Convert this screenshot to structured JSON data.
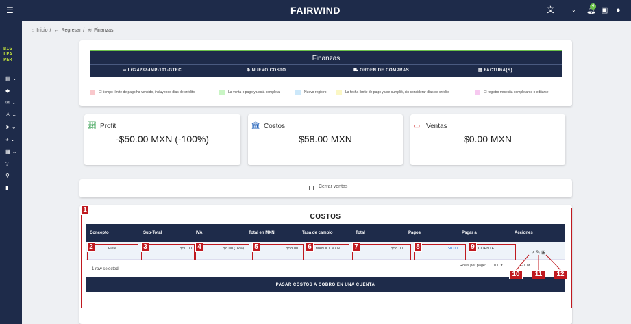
{
  "header": {
    "brand": "FAIRWIND",
    "menu_icon": "hamburger-icon",
    "translate_icon": "translate-icon",
    "notification_count": "4",
    "notification_icon": "bell-icon",
    "chat_icon": "chat-icon",
    "account_icon": "account-icon"
  },
  "sidebar": {
    "logo_lines": [
      "BIG",
      "LEA",
      "PER"
    ]
  },
  "breadcrumb": {
    "home": "Inicio",
    "back": "Regresar",
    "current": "Finanzas"
  },
  "finanzas": {
    "title": "Finanzas",
    "tabs": [
      {
        "label": "LG24237-IMP-101-GTEC",
        "icon": "shipping-icon"
      },
      {
        "label": "NUEVO COSTO",
        "icon": "add-circle-icon"
      },
      {
        "label": "ORDEN DE COMPRAS",
        "icon": "cart-icon"
      },
      {
        "label": "FACTURA(S)",
        "icon": "invoice-icon"
      }
    ]
  },
  "legend": [
    {
      "color": "#f9c8cc",
      "label": "El tiempo límite de pago ha vencido, incluyendo días de crédito"
    },
    {
      "color": "#c9f5c4",
      "label": "La venta o pago ya está completa"
    },
    {
      "color": "#cce8fa",
      "label": "Nuevo registro"
    },
    {
      "color": "#fbf7c4",
      "label": "La fecha límite de pago ya se cumplió, sin considerar días de crédito"
    },
    {
      "color": "#f7c9f0",
      "label": "El registro necesita completarse o editarse"
    }
  ],
  "kpis": {
    "profit": {
      "label": "Profit",
      "value": "-$50.00 MXN (-100%)",
      "icon": "trending-up-icon",
      "color": "#2e9c4a"
    },
    "costos": {
      "label": "Costos",
      "value": "$58.00 MXN",
      "icon": "bank-icon",
      "color": "#1f5fb8"
    },
    "ventas": {
      "label": "Ventas",
      "value": "$0.00 MXN",
      "icon": "credit-card-icon",
      "color": "#d23a3a"
    }
  },
  "cerrar_ventas": "Cerrar ventas",
  "costos": {
    "title": "COSTOS",
    "columns": [
      "Concepto",
      "Sub-Total",
      "IVA",
      "Total en MXN",
      "Tasa de cambio",
      "Total",
      "Pagos",
      "Pagar a",
      "Acciones"
    ],
    "row": {
      "concepto": "Flete",
      "subtotal": "$50.00",
      "iva": "$8.00 (16%)",
      "total_mxn": "$58.00",
      "tasa": "1 MXN = 1 MXN",
      "total": "$58.00",
      "pagos": "$0.00",
      "pagar_a": "EL CLIENTE"
    },
    "selected_text": "1 row selected",
    "rows_per_page_label": "Rows per page:",
    "rows_per_page": "100",
    "range": "1–1 of 1",
    "cobrar_button": "PASAR COSTOS A COBRO EN UNA CUENTA"
  },
  "annotations": [
    "1",
    "2",
    "3",
    "4",
    "5",
    "6",
    "7",
    "8",
    "9",
    "10",
    "11",
    "12"
  ],
  "colors": {
    "navy": "#1e2b4a",
    "accent_green": "#6cc24a",
    "annotation_red": "#c0191f",
    "link_blue": "#1f6fe0"
  }
}
